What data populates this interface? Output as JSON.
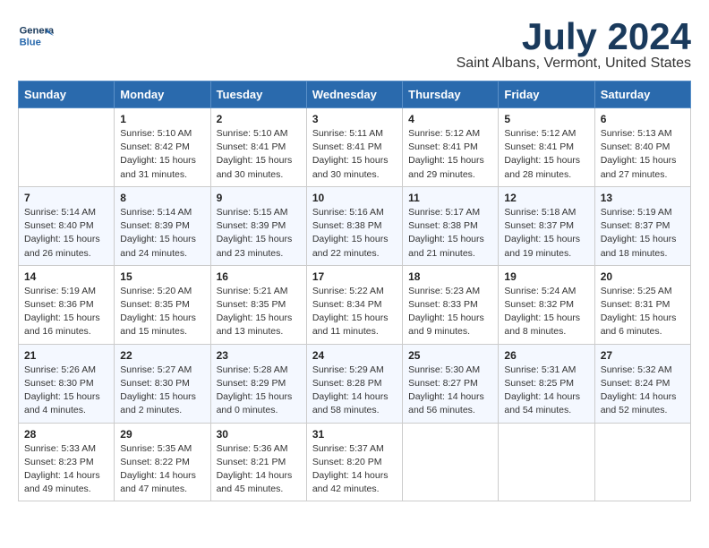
{
  "header": {
    "logo_line1": "General",
    "logo_line2": "Blue",
    "month": "July 2024",
    "location": "Saint Albans, Vermont, United States"
  },
  "weekdays": [
    "Sunday",
    "Monday",
    "Tuesday",
    "Wednesday",
    "Thursday",
    "Friday",
    "Saturday"
  ],
  "weeks": [
    [
      {
        "day": "",
        "info": ""
      },
      {
        "day": "1",
        "info": "Sunrise: 5:10 AM\nSunset: 8:42 PM\nDaylight: 15 hours\nand 31 minutes."
      },
      {
        "day": "2",
        "info": "Sunrise: 5:10 AM\nSunset: 8:41 PM\nDaylight: 15 hours\nand 30 minutes."
      },
      {
        "day": "3",
        "info": "Sunrise: 5:11 AM\nSunset: 8:41 PM\nDaylight: 15 hours\nand 30 minutes."
      },
      {
        "day": "4",
        "info": "Sunrise: 5:12 AM\nSunset: 8:41 PM\nDaylight: 15 hours\nand 29 minutes."
      },
      {
        "day": "5",
        "info": "Sunrise: 5:12 AM\nSunset: 8:41 PM\nDaylight: 15 hours\nand 28 minutes."
      },
      {
        "day": "6",
        "info": "Sunrise: 5:13 AM\nSunset: 8:40 PM\nDaylight: 15 hours\nand 27 minutes."
      }
    ],
    [
      {
        "day": "7",
        "info": "Sunrise: 5:14 AM\nSunset: 8:40 PM\nDaylight: 15 hours\nand 26 minutes."
      },
      {
        "day": "8",
        "info": "Sunrise: 5:14 AM\nSunset: 8:39 PM\nDaylight: 15 hours\nand 24 minutes."
      },
      {
        "day": "9",
        "info": "Sunrise: 5:15 AM\nSunset: 8:39 PM\nDaylight: 15 hours\nand 23 minutes."
      },
      {
        "day": "10",
        "info": "Sunrise: 5:16 AM\nSunset: 8:38 PM\nDaylight: 15 hours\nand 22 minutes."
      },
      {
        "day": "11",
        "info": "Sunrise: 5:17 AM\nSunset: 8:38 PM\nDaylight: 15 hours\nand 21 minutes."
      },
      {
        "day": "12",
        "info": "Sunrise: 5:18 AM\nSunset: 8:37 PM\nDaylight: 15 hours\nand 19 minutes."
      },
      {
        "day": "13",
        "info": "Sunrise: 5:19 AM\nSunset: 8:37 PM\nDaylight: 15 hours\nand 18 minutes."
      }
    ],
    [
      {
        "day": "14",
        "info": "Sunrise: 5:19 AM\nSunset: 8:36 PM\nDaylight: 15 hours\nand 16 minutes."
      },
      {
        "day": "15",
        "info": "Sunrise: 5:20 AM\nSunset: 8:35 PM\nDaylight: 15 hours\nand 15 minutes."
      },
      {
        "day": "16",
        "info": "Sunrise: 5:21 AM\nSunset: 8:35 PM\nDaylight: 15 hours\nand 13 minutes."
      },
      {
        "day": "17",
        "info": "Sunrise: 5:22 AM\nSunset: 8:34 PM\nDaylight: 15 hours\nand 11 minutes."
      },
      {
        "day": "18",
        "info": "Sunrise: 5:23 AM\nSunset: 8:33 PM\nDaylight: 15 hours\nand 9 minutes."
      },
      {
        "day": "19",
        "info": "Sunrise: 5:24 AM\nSunset: 8:32 PM\nDaylight: 15 hours\nand 8 minutes."
      },
      {
        "day": "20",
        "info": "Sunrise: 5:25 AM\nSunset: 8:31 PM\nDaylight: 15 hours\nand 6 minutes."
      }
    ],
    [
      {
        "day": "21",
        "info": "Sunrise: 5:26 AM\nSunset: 8:30 PM\nDaylight: 15 hours\nand 4 minutes."
      },
      {
        "day": "22",
        "info": "Sunrise: 5:27 AM\nSunset: 8:30 PM\nDaylight: 15 hours\nand 2 minutes."
      },
      {
        "day": "23",
        "info": "Sunrise: 5:28 AM\nSunset: 8:29 PM\nDaylight: 15 hours\nand 0 minutes."
      },
      {
        "day": "24",
        "info": "Sunrise: 5:29 AM\nSunset: 8:28 PM\nDaylight: 14 hours\nand 58 minutes."
      },
      {
        "day": "25",
        "info": "Sunrise: 5:30 AM\nSunset: 8:27 PM\nDaylight: 14 hours\nand 56 minutes."
      },
      {
        "day": "26",
        "info": "Sunrise: 5:31 AM\nSunset: 8:25 PM\nDaylight: 14 hours\nand 54 minutes."
      },
      {
        "day": "27",
        "info": "Sunrise: 5:32 AM\nSunset: 8:24 PM\nDaylight: 14 hours\nand 52 minutes."
      }
    ],
    [
      {
        "day": "28",
        "info": "Sunrise: 5:33 AM\nSunset: 8:23 PM\nDaylight: 14 hours\nand 49 minutes."
      },
      {
        "day": "29",
        "info": "Sunrise: 5:35 AM\nSunset: 8:22 PM\nDaylight: 14 hours\nand 47 minutes."
      },
      {
        "day": "30",
        "info": "Sunrise: 5:36 AM\nSunset: 8:21 PM\nDaylight: 14 hours\nand 45 minutes."
      },
      {
        "day": "31",
        "info": "Sunrise: 5:37 AM\nSunset: 8:20 PM\nDaylight: 14 hours\nand 42 minutes."
      },
      {
        "day": "",
        "info": ""
      },
      {
        "day": "",
        "info": ""
      },
      {
        "day": "",
        "info": ""
      }
    ]
  ]
}
